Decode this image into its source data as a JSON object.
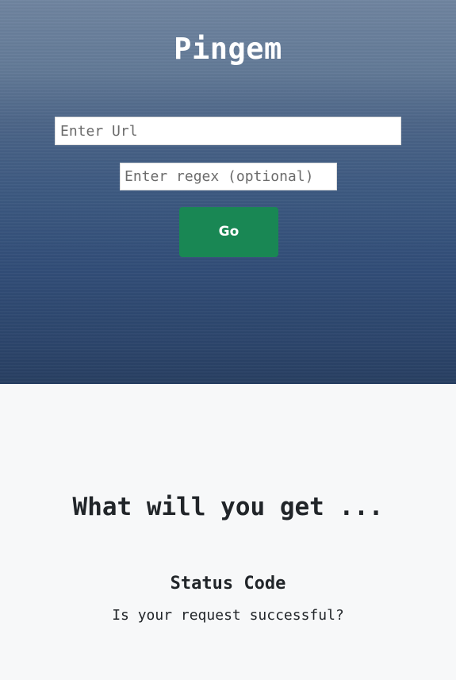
{
  "app": {
    "title": "Pingem"
  },
  "form": {
    "url_placeholder": "Enter Url",
    "url_value": "",
    "regex_placeholder": "Enter regex (optional)",
    "regex_value": "",
    "go_label": "Go"
  },
  "features": {
    "heading": "What will you get ...",
    "items": [
      {
        "title": "Status Code",
        "description": "Is your request successful?"
      }
    ]
  },
  "colors": {
    "go_button": "#198754",
    "section_bg": "#f7f8f9",
    "text_dark": "#212529"
  }
}
